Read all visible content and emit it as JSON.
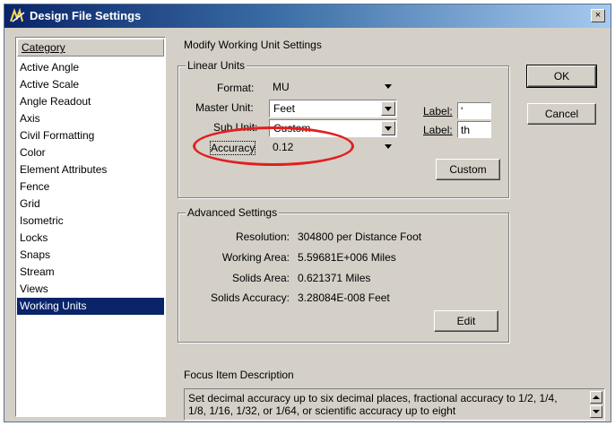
{
  "window": {
    "title": "Design File Settings",
    "close": "×"
  },
  "category": {
    "header": "Category",
    "items": [
      {
        "label": "Active Angle"
      },
      {
        "label": "Active Scale"
      },
      {
        "label": "Angle Readout"
      },
      {
        "label": "Axis"
      },
      {
        "label": "Civil Formatting"
      },
      {
        "label": "Color"
      },
      {
        "label": "Element Attributes"
      },
      {
        "label": "Fence"
      },
      {
        "label": "Grid"
      },
      {
        "label": "Isometric"
      },
      {
        "label": "Locks"
      },
      {
        "label": "Snaps"
      },
      {
        "label": "Stream"
      },
      {
        "label": "Views"
      },
      {
        "label": "Working Units"
      }
    ],
    "selected": "Working Units"
  },
  "main": {
    "heading": "Modify Working Unit Settings",
    "linear": {
      "title": "Linear Units",
      "format_label": "Format:",
      "format_value": "MU",
      "master_label": "Master Unit:",
      "master_value": "Feet",
      "sub_label": "Sub Unit:",
      "sub_value": "Custom",
      "accuracy_label": "Accuracy",
      "accuracy_value": "0.12",
      "label1": "Label:",
      "label1_value": "'",
      "label2": "Label:",
      "label2_value": "th",
      "custom_button": "Custom"
    },
    "advanced": {
      "title": "Advanced Settings",
      "resolution_label": "Resolution:",
      "resolution_value": "304800 per Distance Foot",
      "working_area_label": "Working Area:",
      "working_area_value": "5.59681E+006 Miles",
      "solids_area_label": "Solids Area:",
      "solids_area_value": "0.621371 Miles",
      "solids_accuracy_label": "Solids Accuracy:",
      "solids_accuracy_value": "3.28084E-008 Feet",
      "edit_button": "Edit"
    },
    "ok_button": "OK",
    "cancel_button": "Cancel",
    "focus": {
      "title": "Focus Item Description",
      "text": "Set decimal accuracy up to six decimal places, fractional accuracy to 1/2, 1/4, 1/8, 1/16, 1/32, or 1/64, or scientific accuracy up to eight"
    }
  },
  "colors": {
    "selection": "#0a246a",
    "dialog_bg": "#d4d0c8",
    "highlight_ellipse": "#e02020"
  }
}
